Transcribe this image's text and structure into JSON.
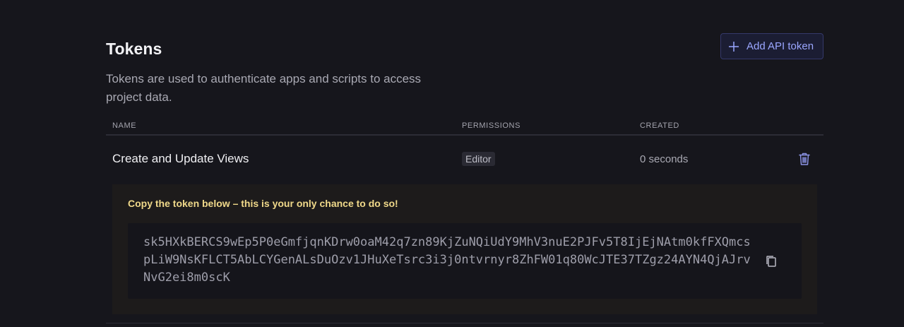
{
  "header": {
    "title": "Tokens",
    "add_button_label": "Add API token",
    "description": "Tokens are used to authenticate apps and scripts to access project data."
  },
  "table": {
    "columns": [
      "NAME",
      "PERMISSIONS",
      "CREATED"
    ],
    "rows": [
      {
        "name": "Create and Update Views",
        "permission": "Editor",
        "created": "0 seconds"
      }
    ]
  },
  "token_panel": {
    "warning": "Copy the token below – this is your only chance to do so!",
    "token": "sk5HXkBERCS9wEp5P0eGmfjqnKDrw0oaM42q7zn89KjZuNQiUdY9MhV3nuE2PJFv5T8IjEjNAtm0kfFXQmcspLiW9NsKFLCT5AbLCYGenALsDuOzv1JHuXeTsrc3i3j0ntvrnyr8ZhFW01q80WcJTE37TZgz24AYN4QjAJrvNvG2ei8m0scK"
  },
  "icons": {
    "add": "plus-icon",
    "delete": "trash-icon",
    "copy": "copy-icon"
  },
  "colors": {
    "background": "#16161c",
    "accent": "#9aa6ff",
    "warning": "#f0d98a"
  }
}
